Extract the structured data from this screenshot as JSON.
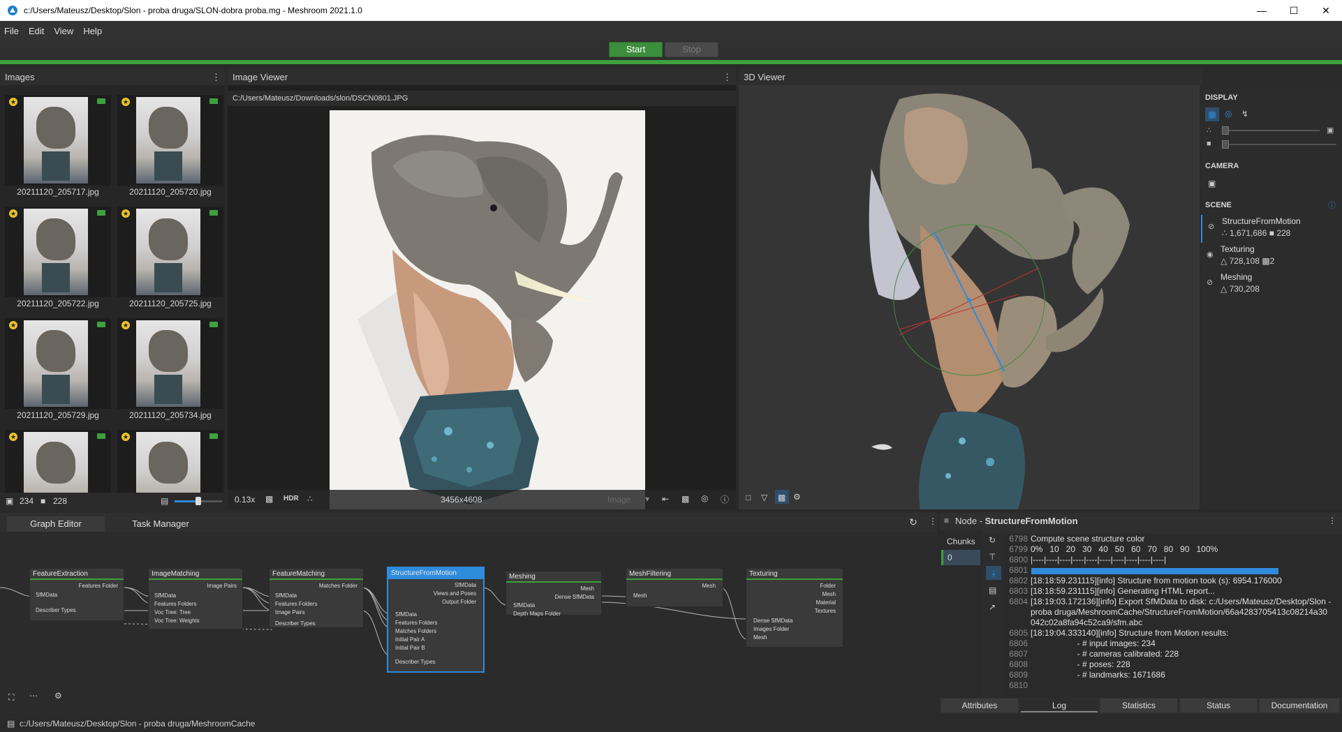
{
  "window": {
    "title": "c:/Users/Mateusz/Desktop/Slon - proba druga/SLON-dobra proba.mg - Meshroom 2021.1.0"
  },
  "menu": [
    "File",
    "Edit",
    "View",
    "Help"
  ],
  "toolbar": {
    "start_label": "Start",
    "stop_label": "Stop"
  },
  "images_panel": {
    "title": "Images",
    "thumbnails": [
      {
        "name": "20211120_205717.jpg"
      },
      {
        "name": "20211120_205720.jpg"
      },
      {
        "name": "20211120_205722.jpg"
      },
      {
        "name": "20211120_205725.jpg"
      },
      {
        "name": "20211120_205729.jpg"
      },
      {
        "name": "20211120_205734.jpg"
      },
      {
        "name": ""
      },
      {
        "name": ""
      }
    ],
    "image_count": "234",
    "camera_count": "228"
  },
  "image_viewer": {
    "title": "Image Viewer",
    "path": "C:/Users/Mateusz/Downloads/slon/DSCN0801.JPG",
    "zoom": "0.13x",
    "hdr": "HDR",
    "resolution": "3456x4608",
    "image_select": "Image"
  },
  "viewer3d": {
    "title": "3D Viewer"
  },
  "side_panel": {
    "display_title": "DISPLAY",
    "camera_title": "CAMERA",
    "scene_title": "SCENE",
    "scene_items": [
      {
        "name": "StructureFromMotion",
        "stat1": "1,671,686",
        "stat2": "228"
      },
      {
        "name": "Texturing",
        "stat1": "728,108",
        "stat2": "2"
      },
      {
        "name": "Meshing",
        "stat1": "730,208",
        "stat2": ""
      }
    ]
  },
  "graph": {
    "tab_graph": "Graph Editor",
    "tab_task": "Task Manager",
    "nodes": {
      "fe": {
        "title": "FeatureExtraction",
        "out": "Features Folder",
        "in1": "SfMData",
        "in2": "Describer Types"
      },
      "im": {
        "title": "ImageMatching",
        "out": "Image Pairs",
        "in1": "SfMData",
        "in2": "Features Folders",
        "in3": "Voc Tree: Tree",
        "in4": "Voc Tree: Weights"
      },
      "fm": {
        "title": "FeatureMatching",
        "out": "Matches Folder",
        "in1": "SfMData",
        "in2": "Features Folders",
        "in3": "Image Pairs",
        "in4": "Describer Types"
      },
      "sfm": {
        "title": "StructureFromMotion",
        "out1": "SfMData",
        "out2": "Views and Poses",
        "out3": "Output Folder",
        "in1": "SfMData",
        "in2": "Features Folders",
        "in3": "Matches Folders",
        "in4": "Initial Pair A",
        "in5": "Initial Pair B",
        "in6": "Describer Types"
      },
      "me": {
        "title": "Meshing",
        "out1": "Mesh",
        "out2": "Dense SfMData",
        "in1": "SfMData",
        "in2": "Depth Maps Folder"
      },
      "mf": {
        "title": "MeshFiltering",
        "out": "Mesh",
        "in1": "Mesh"
      },
      "tx": {
        "title": "Texturing",
        "out1": "Folder",
        "out2": "Mesh",
        "out3": "Material",
        "out4": "Textures",
        "in1": "Dense SfMData",
        "in2": "Images Folder",
        "in3": "Mesh"
      }
    }
  },
  "node_panel": {
    "label_prefix": "Node - ",
    "node_name": "StructureFromMotion",
    "chunks_label": "Chunks",
    "chunk_0": "0",
    "log": [
      {
        "n": "6798",
        "t": "Compute scene structure color"
      },
      {
        "n": "6799",
        "t": "0%   10   20   30   40   50   60   70   80   90   100%"
      },
      {
        "n": "6800",
        "t": "|----|----|----|----|----|----|----|----|----|----|"
      },
      {
        "n": "6801",
        "t": ""
      },
      {
        "n": "6802",
        "t": "[18:18:59.231115][info] Structure from motion took (s): 6954.176000"
      },
      {
        "n": "6803",
        "t": "[18:18:59.231115][info] Generating HTML report..."
      },
      {
        "n": "6804",
        "t": "[18:19:03.172136][info] Export SfMData to disk: c:/Users/Mateusz/Desktop/Slon -"
      },
      {
        "n": "",
        "t": "proba druga/MeshroomCache/StructureFromMotion/66a4283705413c08214a30"
      },
      {
        "n": "",
        "t": "042c02a8fa94c52ca9/sfm.abc"
      },
      {
        "n": "6805",
        "t": "[18:19:04.333140][info] Structure from Motion results:"
      },
      {
        "n": "6806",
        "t": "                    - # input images: 234"
      },
      {
        "n": "6807",
        "t": "                    - # cameras calibrated: 228"
      },
      {
        "n": "6808",
        "t": "                    - # poses: 228"
      },
      {
        "n": "6809",
        "t": "                    - # landmarks: 1671686"
      },
      {
        "n": "6810",
        "t": ""
      }
    ],
    "progress": 1.0,
    "tabs": [
      "Attributes",
      "Log",
      "Statistics",
      "Status",
      "Documentation"
    ]
  },
  "statusbar": {
    "path": "c:/Users/Mateusz/Desktop/Slon - proba druga/MeshroomCache"
  }
}
